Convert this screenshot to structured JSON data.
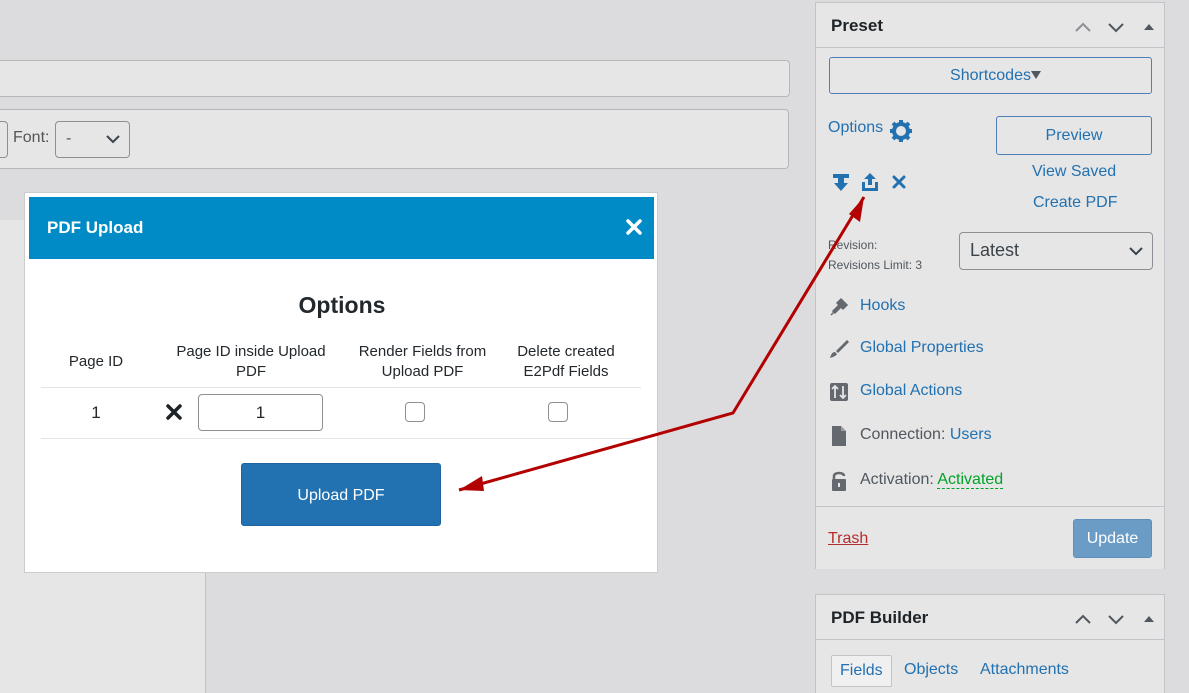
{
  "editor": {
    "font_label": "Font:",
    "font_value": "-"
  },
  "modal": {
    "title": "PDF Upload",
    "heading": "Options",
    "columns": [
      "Page ID",
      "Page ID inside Upload PDF",
      "Render Fields from Upload PDF",
      "Delete created E2Pdf Fields"
    ],
    "row": {
      "page_id": "1",
      "page_id_inside": "1"
    },
    "upload_label": "Upload PDF"
  },
  "preset": {
    "title": "Preset",
    "shortcodes_label": "Shortcodes",
    "options_label": "Options",
    "preview_label": "Preview",
    "view_saved_label": "View Saved",
    "create_pdf_label": "Create PDF",
    "revision_label": "Revision:",
    "revisions_limit_label": "Revisions Limit: 3",
    "revision_value": "Latest",
    "items": [
      {
        "icon": "plug-icon",
        "label": "Hooks"
      },
      {
        "icon": "paintbrush-icon",
        "label": "Global Properties"
      },
      {
        "icon": "actions-icon",
        "label": "Global Actions"
      }
    ],
    "connection_label": "Connection:",
    "connection_value": "Users",
    "activation_label": "Activation:",
    "activation_value": "Activated",
    "trash_label": "Trash",
    "update_label": "Update"
  },
  "pdf_builder": {
    "title": "PDF Builder",
    "tabs": [
      "Fields",
      "Objects",
      "Attachments"
    ]
  },
  "colors": {
    "modal_header": "#018bc6",
    "primary_button": "#2271b1",
    "arrow": "#b30000",
    "activated": "#00a32a",
    "trash": "#b32d2e"
  }
}
